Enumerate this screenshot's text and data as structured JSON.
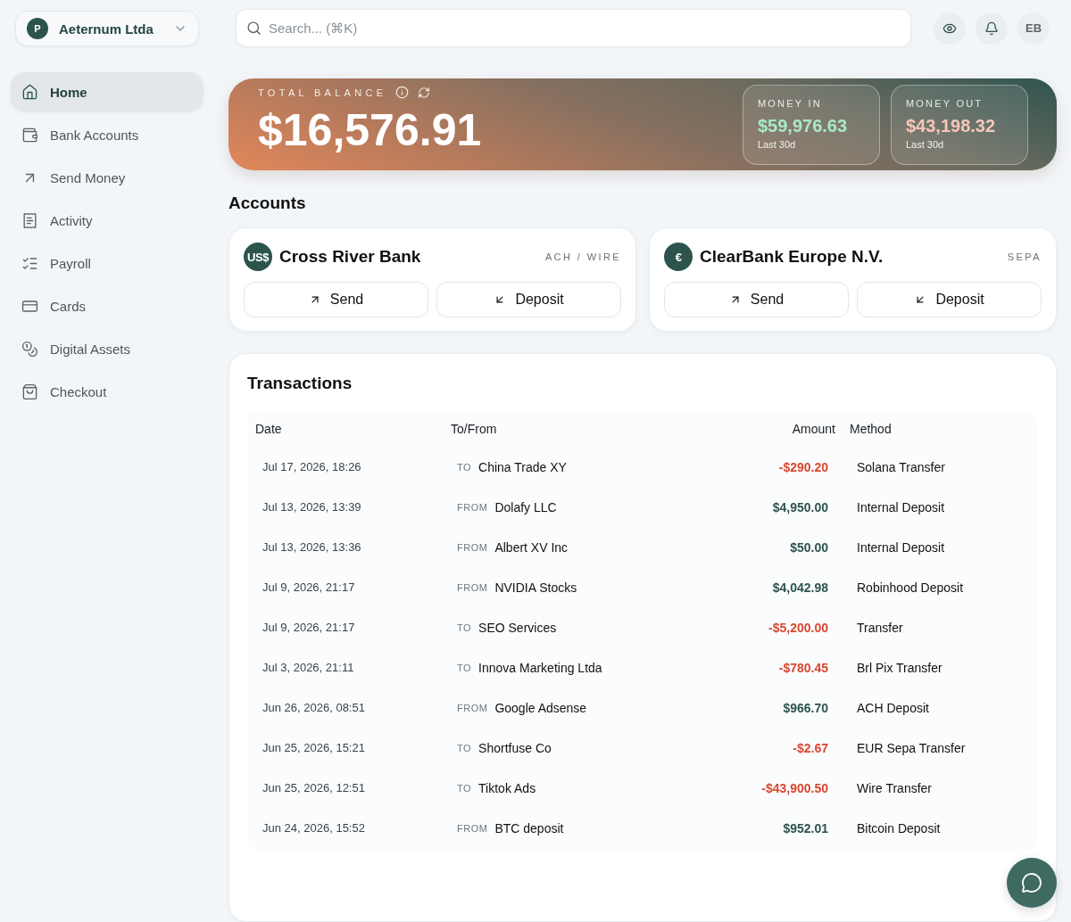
{
  "org_switcher": {
    "avatar": "P",
    "name": "Aeternum Ltda"
  },
  "sidebar": {
    "items": [
      {
        "label": "Home",
        "selected": true
      },
      {
        "label": "Bank Accounts",
        "selected": false
      },
      {
        "label": "Send Money",
        "selected": false
      },
      {
        "label": "Activity",
        "selected": false
      },
      {
        "label": "Payroll",
        "selected": false
      },
      {
        "label": "Cards",
        "selected": false
      },
      {
        "label": "Digital Assets",
        "selected": false
      },
      {
        "label": "Checkout",
        "selected": false
      }
    ]
  },
  "search": {
    "placeholder": "Search... (⌘K)"
  },
  "header_actions": {
    "avatar": "EB"
  },
  "balance": {
    "label": "TOTAL BALANCE",
    "amount": "$16,576.91",
    "stats": [
      {
        "kind": "in",
        "label": "MONEY IN",
        "amount": "$59,976.63",
        "period": "Last 30d"
      },
      {
        "kind": "out",
        "label": "MONEY OUT",
        "amount": "$43,198.32",
        "period": "Last 30d"
      }
    ]
  },
  "accounts": {
    "title": "Accounts",
    "items": [
      {
        "badge": "US$",
        "name": "Cross River Bank",
        "rails": "ACH / WIRE",
        "actions": [
          "Send",
          "Deposit"
        ]
      },
      {
        "badge": "€",
        "name": "ClearBank Europe N.V.",
        "rails": "SEPA",
        "actions": [
          "Send",
          "Deposit"
        ]
      }
    ]
  },
  "transactions": {
    "title": "Transactions",
    "columns": [
      "Date",
      "To/From",
      "Amount",
      "Method"
    ],
    "rows": [
      {
        "date": "Jul 17, 2026, 18:26",
        "direction": "TO",
        "party": "China Trade XY",
        "amount": "-$290.20",
        "kind": "debit",
        "method": "Solana Transfer"
      },
      {
        "date": "Jul 13, 2026, 13:39",
        "direction": "FROM",
        "party": "Dolafy LLC",
        "amount": "$4,950.00",
        "kind": "credit",
        "method": "Internal Deposit"
      },
      {
        "date": "Jul 13, 2026, 13:36",
        "direction": "FROM",
        "party": "Albert XV Inc",
        "amount": "$50.00",
        "kind": "credit",
        "method": "Internal Deposit"
      },
      {
        "date": "Jul 9, 2026, 21:17",
        "direction": "FROM",
        "party": "NVIDIA Stocks",
        "amount": "$4,042.98",
        "kind": "credit",
        "method": "Robinhood Deposit"
      },
      {
        "date": "Jul 9, 2026, 21:17",
        "direction": "TO",
        "party": "SEO Services",
        "amount": "-$5,200.00",
        "kind": "debit",
        "method": "Transfer"
      },
      {
        "date": "Jul 3, 2026, 21:11",
        "direction": "TO",
        "party": "Innova Marketing Ltda",
        "amount": "-$780.45",
        "kind": "debit",
        "method": "Brl Pix Transfer"
      },
      {
        "date": "Jun 26, 2026, 08:51",
        "direction": "FROM",
        "party": "Google Adsense",
        "amount": "$966.70",
        "kind": "credit",
        "method": "ACH Deposit"
      },
      {
        "date": "Jun 25, 2026, 15:21",
        "direction": "TO",
        "party": "Shortfuse Co",
        "amount": "-$2.67",
        "kind": "debit",
        "method": "EUR Sepa Transfer"
      },
      {
        "date": "Jun 25, 2026, 12:51",
        "direction": "TO",
        "party": "Tiktok Ads",
        "amount": "-$43,900.50",
        "kind": "debit",
        "method": "Wire Transfer"
      },
      {
        "date": "Jun 24, 2026, 15:52",
        "direction": "FROM",
        "party": "BTC deposit",
        "amount": "$952.01",
        "kind": "credit",
        "method": "Bitcoin Deposit"
      }
    ]
  }
}
